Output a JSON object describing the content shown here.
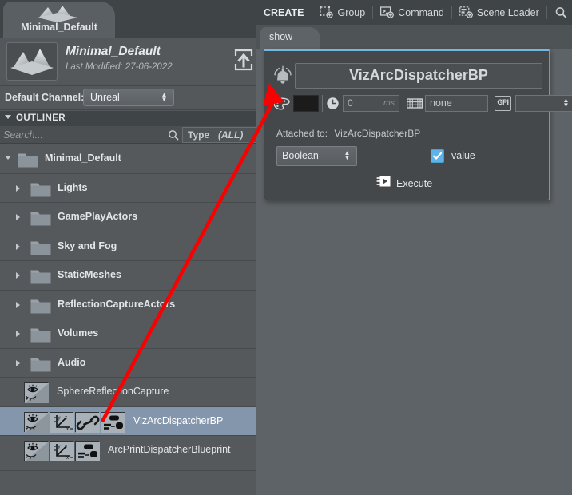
{
  "scene": {
    "tab_label": "Minimal_Default",
    "tab_icon": "mountain-scene-icon",
    "title": "Minimal_Default",
    "modified": "Last Modified: 27-06-2022",
    "thumbnail_icon": "mountain-scene-icon",
    "upload_icon": "upload-icon",
    "channel_label": "Default Channel:",
    "channel_value": "Unreal"
  },
  "outliner": {
    "title": "OUTLINER",
    "collapse_icon": "caret-down-icon",
    "search_placeholder": "Search...",
    "search_value": "",
    "search_icon": "search-icon",
    "type_filter_label": "Type",
    "type_filter_value": "(ALL)",
    "rows": [
      {
        "label": "Minimal_Default",
        "kind": "folder",
        "depth": 0,
        "expanded": true,
        "selected": false
      },
      {
        "label": "Lights",
        "kind": "folder",
        "depth": 1,
        "expanded": false,
        "selected": false
      },
      {
        "label": "GamePlayActors",
        "kind": "folder",
        "depth": 1,
        "expanded": false,
        "selected": false
      },
      {
        "label": "Sky and Fog",
        "kind": "folder",
        "depth": 1,
        "expanded": false,
        "selected": false
      },
      {
        "label": "StaticMeshes",
        "kind": "folder",
        "depth": 1,
        "expanded": false,
        "selected": false
      },
      {
        "label": "ReflectionCaptureActors",
        "kind": "folder",
        "depth": 1,
        "expanded": false,
        "selected": false
      },
      {
        "label": "Volumes",
        "kind": "folder",
        "depth": 1,
        "expanded": false,
        "selected": false
      },
      {
        "label": "Audio",
        "kind": "folder",
        "depth": 1,
        "expanded": false,
        "selected": false
      },
      {
        "label": "SphereReflectionCapture",
        "kind": "actor",
        "depth": 2,
        "icons": [
          "visibility-icon"
        ],
        "selected": false
      },
      {
        "label": "VizArcDispatcherBP",
        "kind": "actor",
        "depth": 2,
        "icons": [
          "visibility-icon",
          "axis-transform-icon",
          "chain-link-icon",
          "blueprint-icon"
        ],
        "selected": true
      },
      {
        "label": "ArcPrintDispatcherBlueprint",
        "kind": "actor",
        "depth": 2,
        "icons": [
          "visibility-icon",
          "axis-transform-icon",
          "blueprint-icon"
        ],
        "selected": false
      }
    ]
  },
  "toolbar": {
    "create_label": "CREATE",
    "items": [
      {
        "label": "Group",
        "icon": "group-add-icon"
      },
      {
        "label": "Command",
        "icon": "command-add-icon"
      },
      {
        "label": "Scene Loader",
        "icon": "scene-loader-add-icon"
      },
      {
        "label": "Search",
        "icon": "search-icon"
      }
    ]
  },
  "show_tab": {
    "label": "show"
  },
  "dispatcher": {
    "bell_icon": "bell-ringing-icon",
    "name": "VizArcDispatcherBP",
    "palette_icon": "palette-icon",
    "color_value": "#1b1b1b",
    "clock_icon": "clock-icon",
    "delay_value": "0",
    "delay_unit": "ms",
    "keyboard_icon": "keyboard-icon",
    "shortcut_value": "none",
    "gpi_icon_label": "GPI",
    "gpi_value": "",
    "attached_label": "Attached to:",
    "attached_value": "VizArcDispatcherBP",
    "type_value": "Boolean",
    "value_checked": true,
    "value_label": "value",
    "execute_label": "Execute",
    "execute_icon": "execute-play-icon",
    "accent_color": "#74b7e0",
    "checkbox_color": "#60b3e8"
  },
  "annotation": {
    "arrow_color": "#f60202",
    "from": "chain-link-icon on VizArcDispatcherBP row",
    "to": "bell-ringing-icon on dispatcher card"
  }
}
